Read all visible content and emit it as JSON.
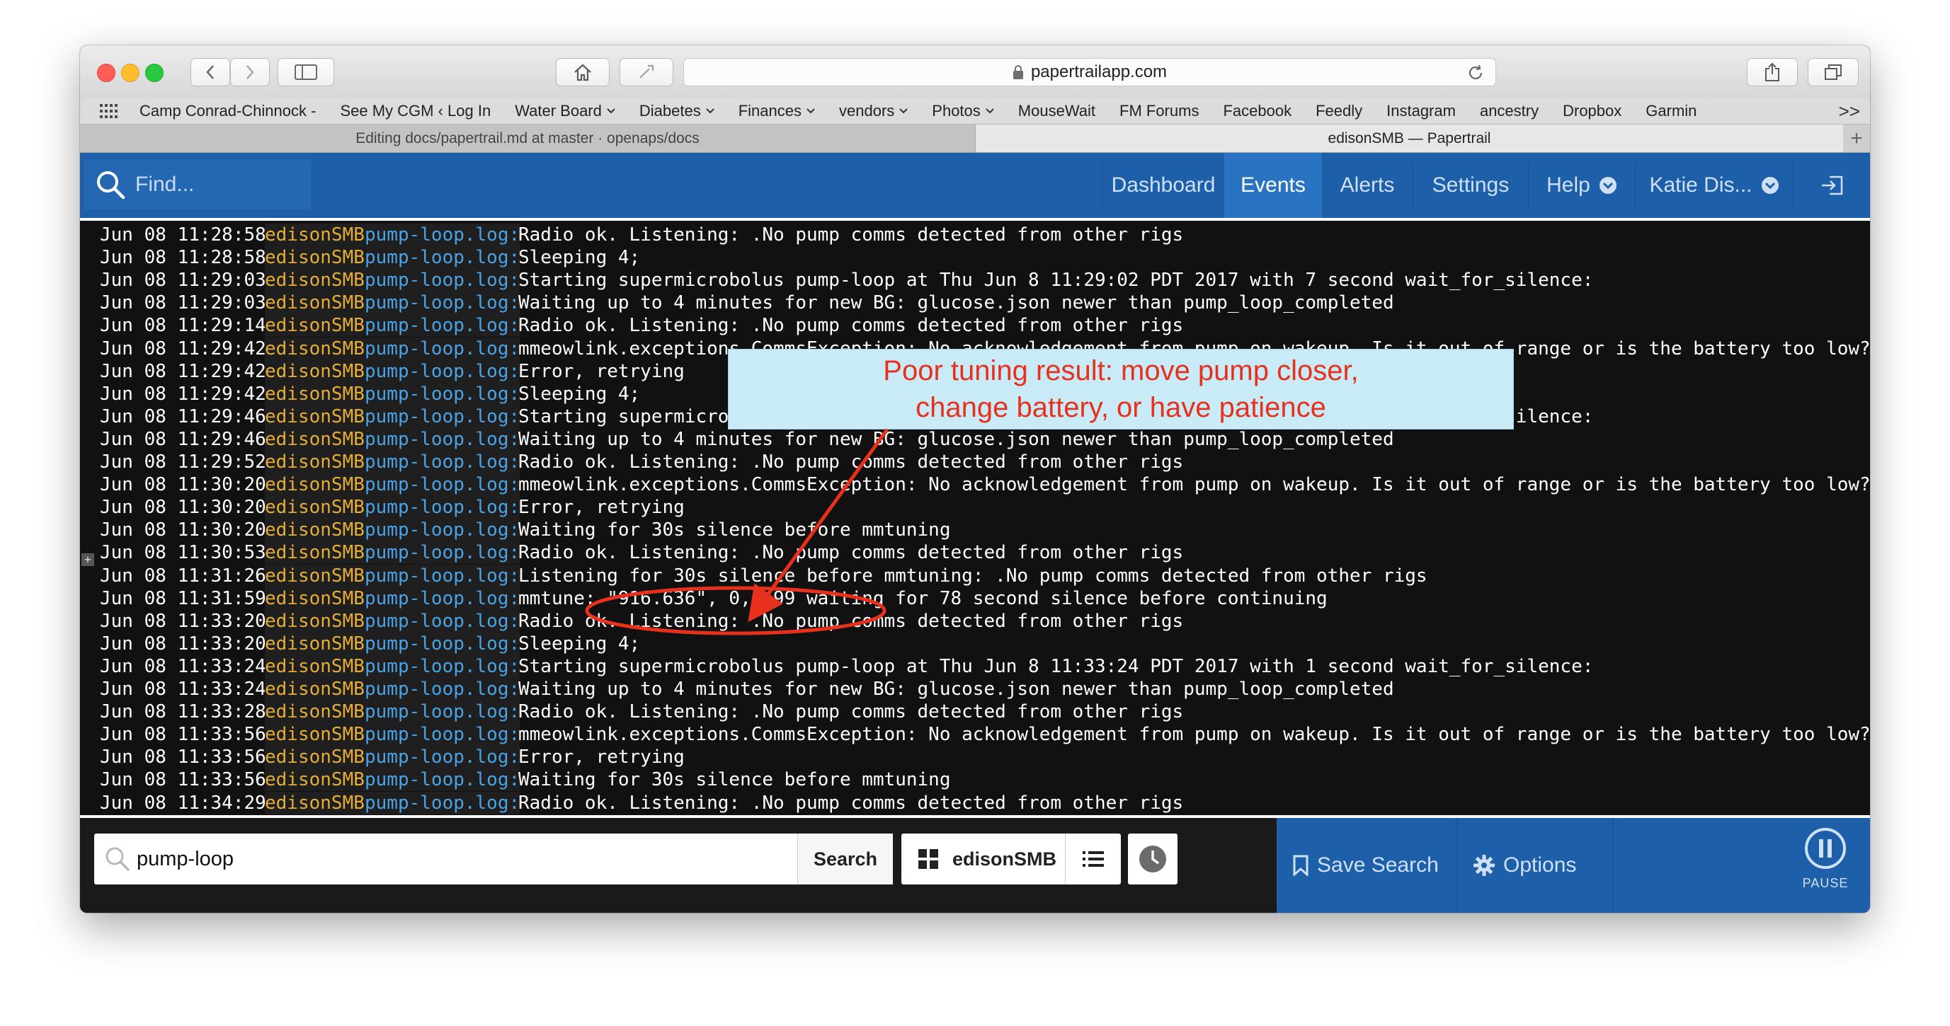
{
  "browser": {
    "url": "papertrailapp.com",
    "bookmarks": [
      {
        "label": "Camp Conrad-Chinnock -",
        "dropdown": false
      },
      {
        "label": "See My CGM ‹ Log In",
        "dropdown": false
      },
      {
        "label": "Water Board",
        "dropdown": true
      },
      {
        "label": "Diabetes",
        "dropdown": true
      },
      {
        "label": "Finances",
        "dropdown": true
      },
      {
        "label": "vendors",
        "dropdown": true
      },
      {
        "label": "Photos",
        "dropdown": true
      },
      {
        "label": "MouseWait",
        "dropdown": false
      },
      {
        "label": "FM Forums",
        "dropdown": false
      },
      {
        "label": "Facebook",
        "dropdown": false
      },
      {
        "label": "Feedly",
        "dropdown": false
      },
      {
        "label": "Instagram",
        "dropdown": false
      },
      {
        "label": "ancestry",
        "dropdown": false
      },
      {
        "label": "Dropbox",
        "dropdown": false
      },
      {
        "label": "Garmin",
        "dropdown": false
      }
    ],
    "bookmarks_more": ">>",
    "tabs": [
      {
        "title": "Editing docs/papertrail.md at master · openaps/docs",
        "active": false
      },
      {
        "title": "edisonSMB — Papertrail",
        "active": true
      }
    ],
    "new_tab_label": "+"
  },
  "nav": {
    "find_placeholder": "Find...",
    "items": [
      {
        "label": "Dashboard",
        "active": false,
        "dropdown": false
      },
      {
        "label": "Events",
        "active": true,
        "dropdown": false
      },
      {
        "label": "Alerts",
        "active": false,
        "dropdown": false
      },
      {
        "label": "Settings",
        "active": false,
        "dropdown": false
      },
      {
        "label": "Help",
        "active": false,
        "dropdown": true
      },
      {
        "label": "Katie Dis...",
        "active": false,
        "dropdown": true
      }
    ]
  },
  "logs": [
    {
      "ts": "Jun 08 11:28:58",
      "host": "edisonSMB",
      "program": "pump-loop.log:",
      "message": "Radio ok. Listening: .No pump comms detected from other rigs"
    },
    {
      "ts": "Jun 08 11:28:58",
      "host": "edisonSMB",
      "program": "pump-loop.log:",
      "message": "Sleeping 4;"
    },
    {
      "ts": "Jun 08 11:29:03",
      "host": "edisonSMB",
      "program": "pump-loop.log:",
      "message": "Starting supermicrobolus pump-loop at Thu Jun 8 11:29:02 PDT 2017 with 7 second wait_for_silence:"
    },
    {
      "ts": "Jun 08 11:29:03",
      "host": "edisonSMB",
      "program": "pump-loop.log:",
      "message": "Waiting up to 4 minutes for new BG: glucose.json newer than pump_loop_completed"
    },
    {
      "ts": "Jun 08 11:29:14",
      "host": "edisonSMB",
      "program": "pump-loop.log:",
      "message": "Radio ok. Listening: .No pump comms detected from other rigs"
    },
    {
      "ts": "Jun 08 11:29:42",
      "host": "edisonSMB",
      "program": "pump-loop.log:",
      "message": "mmeowlink.exceptions.CommsException: No acknowledgement from pump on wakeup. Is it out of range or is the battery too low?"
    },
    {
      "ts": "Jun 08 11:29:42",
      "host": "edisonSMB",
      "program": "pump-loop.log:",
      "message": "Error, retrying"
    },
    {
      "ts": "Jun 08 11:29:42",
      "host": "edisonSMB",
      "program": "pump-loop.log:",
      "message": "Sleeping 4;"
    },
    {
      "ts": "Jun 08 11:29:46",
      "host": "edisonSMB",
      "program": "pump-loop.log:",
      "message": "Starting supermicrobolus pump-loop at Thu Jun 8 11:29:46 PDT 2017 with 3 second wait_for_silence:"
    },
    {
      "ts": "Jun 08 11:29:46",
      "host": "edisonSMB",
      "program": "pump-loop.log:",
      "message": "Waiting up to 4 minutes for new BG: glucose.json newer than pump_loop_completed"
    },
    {
      "ts": "Jun 08 11:29:52",
      "host": "edisonSMB",
      "program": "pump-loop.log:",
      "message": "Radio ok. Listening: .No pump comms detected from other rigs"
    },
    {
      "ts": "Jun 08 11:30:20",
      "host": "edisonSMB",
      "program": "pump-loop.log:",
      "message": "mmeowlink.exceptions.CommsException: No acknowledgement from pump on wakeup. Is it out of range or is the battery too low?"
    },
    {
      "ts": "Jun 08 11:30:20",
      "host": "edisonSMB",
      "program": "pump-loop.log:",
      "message": "Error, retrying"
    },
    {
      "ts": "Jun 08 11:30:20",
      "host": "edisonSMB",
      "program": "pump-loop.log:",
      "message": "Waiting for 30s silence before mmtuning"
    },
    {
      "ts": "Jun 08 11:30:53",
      "host": "edisonSMB",
      "program": "pump-loop.log:",
      "message": "Radio ok. Listening: .No pump comms detected from other rigs"
    },
    {
      "ts": "Jun 08 11:31:26",
      "host": "edisonSMB",
      "program": "pump-loop.log:",
      "message": "Listening for 30s silence before mmtuning: .No pump comms detected from other rigs"
    },
    {
      "ts": "Jun 08 11:31:59",
      "host": "edisonSMB",
      "program": "pump-loop.log:",
      "message": "mmtune: \"916.636\", 0, -99 waiting for 78 second silence before continuing"
    },
    {
      "ts": "Jun 08 11:33:20",
      "host": "edisonSMB",
      "program": "pump-loop.log:",
      "message": "Radio ok. Listening: .No pump comms detected from other rigs"
    },
    {
      "ts": "Jun 08 11:33:20",
      "host": "edisonSMB",
      "program": "pump-loop.log:",
      "message": "Sleeping 4;"
    },
    {
      "ts": "Jun 08 11:33:24",
      "host": "edisonSMB",
      "program": "pump-loop.log:",
      "message": "Starting supermicrobolus pump-loop at Thu Jun 8 11:33:24 PDT 2017 with 1 second wait_for_silence:"
    },
    {
      "ts": "Jun 08 11:33:24",
      "host": "edisonSMB",
      "program": "pump-loop.log:",
      "message": "Waiting up to 4 minutes for new BG: glucose.json newer than pump_loop_completed"
    },
    {
      "ts": "Jun 08 11:33:28",
      "host": "edisonSMB",
      "program": "pump-loop.log:",
      "message": "Radio ok. Listening: .No pump comms detected from other rigs"
    },
    {
      "ts": "Jun 08 11:33:56",
      "host": "edisonSMB",
      "program": "pump-loop.log:",
      "message": "mmeowlink.exceptions.CommsException: No acknowledgement from pump on wakeup. Is it out of range or is the battery too low?"
    },
    {
      "ts": "Jun 08 11:33:56",
      "host": "edisonSMB",
      "program": "pump-loop.log:",
      "message": "Error, retrying"
    },
    {
      "ts": "Jun 08 11:33:56",
      "host": "edisonSMB",
      "program": "pump-loop.log:",
      "message": "Waiting for 30s silence before mmtuning"
    },
    {
      "ts": "Jun 08 11:34:29",
      "host": "edisonSMB",
      "program": "pump-loop.log:",
      "message": "Radio ok. Listening: .No pump comms detected from other rigs"
    }
  ],
  "expander_label": "+",
  "annotation": {
    "line1": "Poor tuning result: move pump closer,",
    "line2": "change battery, or have patience",
    "color": "#e8311d"
  },
  "bottom": {
    "search_value": "pump-loop",
    "search_button": "Search",
    "group_label": "edisonSMB",
    "save_search": "Save Search",
    "options": "Options",
    "pause": "PAUSE"
  },
  "colors": {
    "nav_blue": "#1d5fa8",
    "nav_active": "#2a73c2",
    "timestamp": "#ffffff",
    "host": "#e5ad35",
    "program": "#4aa3e6",
    "log_bg": "#111111"
  },
  "icons": {
    "find": "search-icon",
    "home": "home-icon",
    "share": "share-icon",
    "tabs": "tabs-overview-icon",
    "pause": "pause-circle-icon",
    "clock": "clock-icon",
    "save": "bookmark-icon",
    "options": "gear-icon"
  }
}
